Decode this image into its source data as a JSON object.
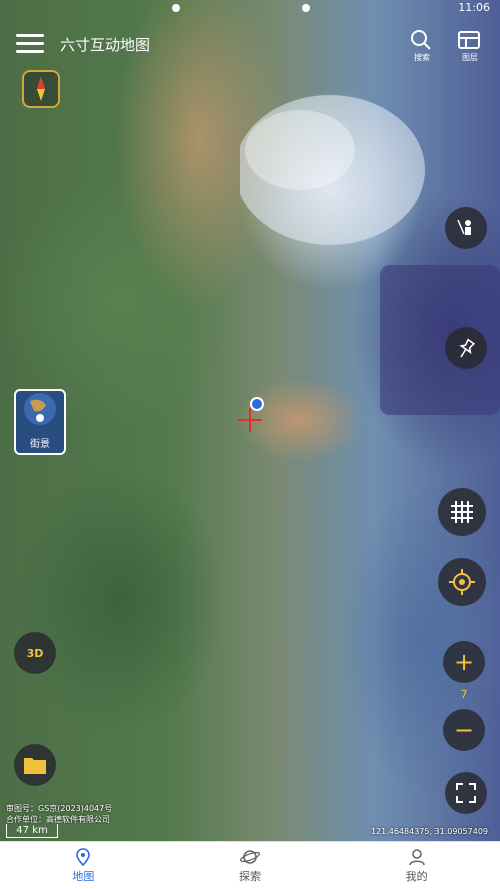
{
  "status_bar": {
    "time": "11:06"
  },
  "header": {
    "title": "六寸互动地图",
    "search_label": "搜索",
    "layers_label": "图层"
  },
  "left_controls": {
    "street_view_label": "街景",
    "three_d_label": "3D"
  },
  "right_controls": {
    "zoom_in": "+",
    "zoom_out": "−",
    "zoom_level": "7"
  },
  "attribution": {
    "line1": "审图号：GS京(2023)4047号",
    "line2": "合作单位：高德软件有限公司",
    "scale": "47 km"
  },
  "coordinates": "121.46484375, 31.09057409",
  "tabs": [
    {
      "label": "地图",
      "active": true
    },
    {
      "label": "探索",
      "active": false
    },
    {
      "label": "我的",
      "active": false
    }
  ],
  "colors": {
    "accent": "#2c6be0",
    "control_yellow": "#f2c23c"
  }
}
